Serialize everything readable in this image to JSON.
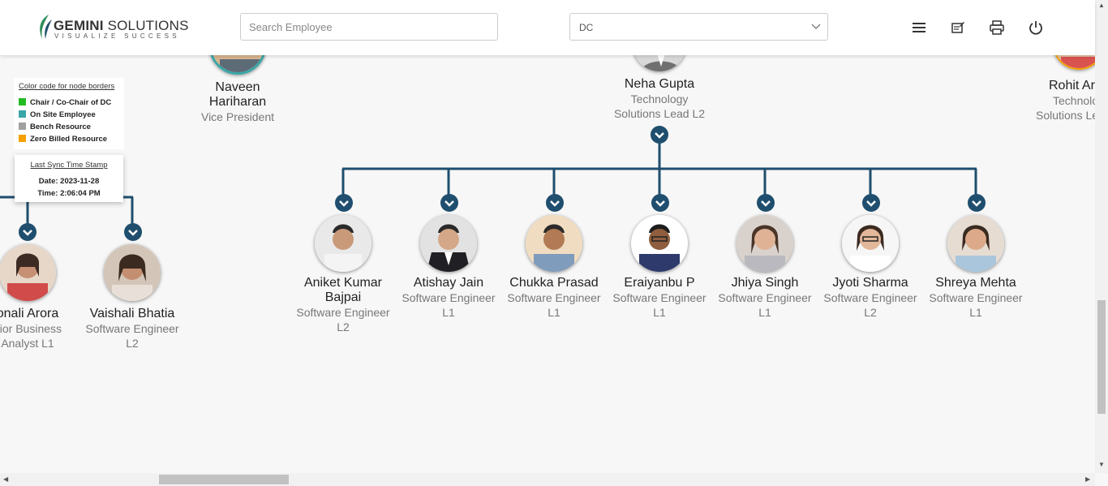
{
  "header": {
    "logo_name_bold": "GEMINI",
    "logo_name_rest": " SOLUTIONS",
    "logo_tagline": "VISUALIZE SUCCESS",
    "search_placeholder": "Search Employee",
    "department_selected": "DC",
    "icons": [
      "menu-icon",
      "notes-icon",
      "print-icon",
      "power-icon"
    ]
  },
  "legend": {
    "title": "Color code for node borders",
    "items": [
      {
        "label": "Chair / Co-Chair of DC",
        "color": "#22bb22"
      },
      {
        "label": "On Site Employee",
        "color": "#3aa6a6"
      },
      {
        "label": "Bench Resource",
        "color": "#a0a0a0"
      },
      {
        "label": "Zero Billed Resource",
        "color": "#f5a100"
      }
    ]
  },
  "sync": {
    "title": "Last Sync Time Stamp",
    "date": "Date: 2023-11-28",
    "time": "Time: 2:06:04 PM"
  },
  "colors": {
    "connector": "#1f4e6e",
    "accent": "#1f4e6e"
  },
  "top_row": [
    {
      "name_line1": "Naveen",
      "name_line2": "Hariharan",
      "title_line1": "Vice President",
      "title_line2": ""
    },
    {
      "name_line1": "Neha Gupta",
      "name_line2": "",
      "title_line1": "Technology",
      "title_line2": "Solutions Lead L2"
    },
    {
      "name_line1": "Rohit Ar",
      "name_line2": "",
      "title_line1": "Technolo",
      "title_line2": "Solutions Le"
    }
  ],
  "left_children": [
    {
      "name": "onali Arora",
      "title_line1": "nior Business",
      "title_line2": "Analyst L1"
    },
    {
      "name": "Vaishali Bhatia",
      "title_line1": "Software Engineer",
      "title_line2": "L2"
    }
  ],
  "neha_children": [
    {
      "name_line1": "Aniket Kumar",
      "name_line2": "Bajpai",
      "title_line1": "Software Engineer",
      "title_line2": "L2"
    },
    {
      "name_line1": "Atishay Jain",
      "name_line2": "",
      "title_line1": "Software Engineer",
      "title_line2": "L1"
    },
    {
      "name_line1": "Chukka Prasad",
      "name_line2": "",
      "title_line1": "Software Engineer",
      "title_line2": "L1"
    },
    {
      "name_line1": "Eraiyanbu P",
      "name_line2": "",
      "title_line1": "Software Engineer",
      "title_line2": "L1"
    },
    {
      "name_line1": "Jhiya Singh",
      "name_line2": "",
      "title_line1": "Software Engineer",
      "title_line2": "L1"
    },
    {
      "name_line1": "Jyoti Sharma",
      "name_line2": "",
      "title_line1": "Software Engineer",
      "title_line2": "L2"
    },
    {
      "name_line1": "Shreya Mehta",
      "name_line2": "",
      "title_line1": "Software Engineer",
      "title_line2": "L1"
    }
  ]
}
